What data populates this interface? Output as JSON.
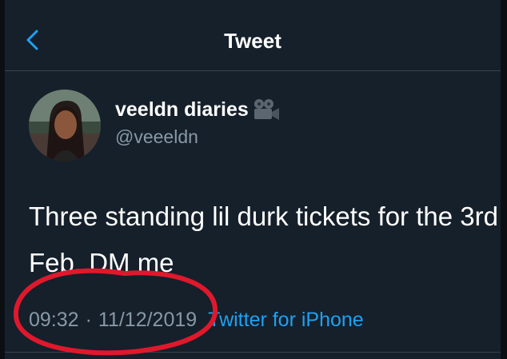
{
  "header": {
    "title": "Tweet",
    "back_icon": "chevron-left-icon"
  },
  "tweet": {
    "author": {
      "display_name": "veeldn diaries",
      "handle": "@veeeldn",
      "name_emoji_icon": "movie-camera-icon"
    },
    "text": "Three standing lil durk tickets for the 3rd Feb. DM me",
    "time": "09:32",
    "separator": "·",
    "date": "11/12/2019",
    "source": "Twitter for iPhone"
  },
  "colors": {
    "background": "#15202b",
    "primary_text": "#ffffff",
    "secondary_text": "#8899a6",
    "accent": "#1da1f2",
    "annotation_circle": "#e0182c"
  }
}
